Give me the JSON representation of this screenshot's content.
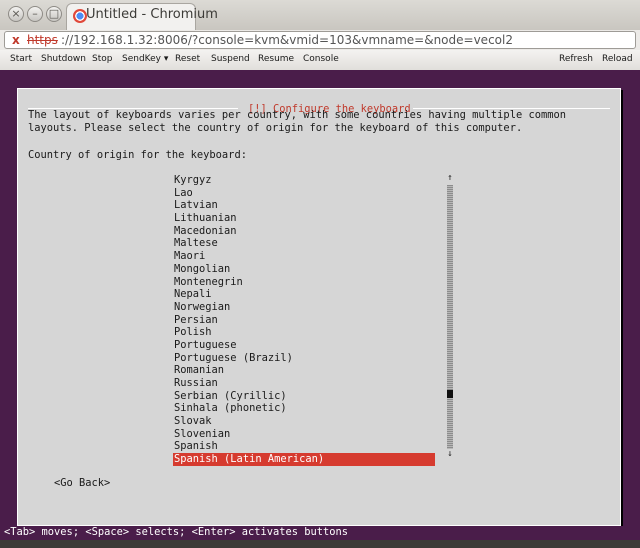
{
  "window": {
    "title": "Untitled - Chromium",
    "buttons": {
      "close": "×",
      "minimize": "–",
      "maximize": "□"
    }
  },
  "address_bar": {
    "scheme": "https",
    "rest": "://192.168.1.32:8006/?console=kvm&vmid=103&vmname=&node=vecol2",
    "security_icon": "insecure-x-icon"
  },
  "toolbar": {
    "start": "Start",
    "shutdown": "Shutdown",
    "stop": "Stop",
    "sendkey": "SendKey ▾",
    "reset": "Reset",
    "suspend": "Suspend",
    "resume": "Resume",
    "console": "Console",
    "refresh": "Refresh",
    "reload": "Reload"
  },
  "dialog": {
    "title": "[!] Configure the keyboard",
    "description_line1": "The layout of keyboards varies per country, with some countries having multiple common",
    "description_line2": "layouts. Please select the country of origin for the keyboard of this computer.",
    "prompt": "Country of origin for the keyboard:",
    "countries": [
      "Kyrgyz",
      "Lao",
      "Latvian",
      "Lithuanian",
      "Macedonian",
      "Maltese",
      "Maori",
      "Mongolian",
      "Montenegrin",
      "Nepali",
      "Norwegian",
      "Persian",
      "Polish",
      "Portuguese",
      "Portuguese (Brazil)",
      "Romanian",
      "Russian",
      "Serbian (Cyrillic)",
      "Sinhala (phonetic)",
      "Slovak",
      "Slovenian",
      "Spanish",
      "Spanish (Latin American)"
    ],
    "selected_index": 22,
    "scroll_up": "↑",
    "scroll_down": "↓",
    "go_back": "<Go Back>"
  },
  "statusbar": {
    "text": "<Tab> moves; <Space> selects; <Enter> activates buttons"
  },
  "colors": {
    "installer_background": "#4a1d4a",
    "dialog_background": "#d6d6d6",
    "selection": "#d63b2f",
    "title_text": "#c0392b"
  }
}
